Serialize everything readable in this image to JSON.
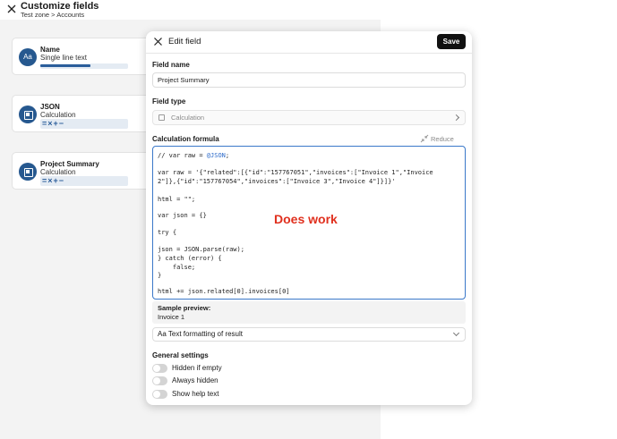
{
  "header": {
    "title": "Customize fields",
    "breadcrumb": "Test zone > Accounts"
  },
  "field_cards": [
    {
      "name": "Name",
      "type": "Single line text",
      "icon": "Aa"
    },
    {
      "name": "JSON",
      "type": "Calculation",
      "ops": "=×+−"
    },
    {
      "name": "Project Summary",
      "type": "Calculation",
      "ops": "=×+−"
    }
  ],
  "modal": {
    "title": "Edit field",
    "save_label": "Save",
    "field_name_label": "Field name",
    "field_name_value": "Project Summary",
    "field_type_label": "Field type",
    "field_type_value": "Calculation",
    "formula_label": "Calculation formula",
    "reduce_label": "Reduce",
    "code": {
      "line1_prefix": "// var raw = ",
      "line1_token": "@JSON",
      "line1_suffix": ";",
      "line2": "var raw = '{\"related\":[{\"id\":\"157767051\",\"invoices\":[\"Invoice 1\",\"Invoice",
      "line3": "2\"]},{\"id\":\"157767054\",\"invoices\":[\"Invoice 3\",\"Invoice 4\"]}]}'",
      "line4": "html = \"\";",
      "line5": "var json = {}",
      "line6": "try {",
      "line7": "json = JSON.parse(raw);",
      "line8": "} catch (error) {",
      "line9": "    false;",
      "line10": "}",
      "line11": "html += json.related[0].invoices[0]"
    },
    "annotation": "Does work",
    "preview_label": "Sample preview:",
    "preview_value": "Invoice 1",
    "text_format_label": "Aa Text formatting of result",
    "general_settings_label": "General settings",
    "toggles": [
      {
        "label": "Hidden if empty",
        "on": false
      },
      {
        "label": "Always hidden",
        "on": false
      },
      {
        "label": "Show help text",
        "on": false
      }
    ]
  },
  "colors": {
    "accent": "#26588f",
    "annotation": "#e0301e",
    "code_border": "#3a78c9"
  }
}
